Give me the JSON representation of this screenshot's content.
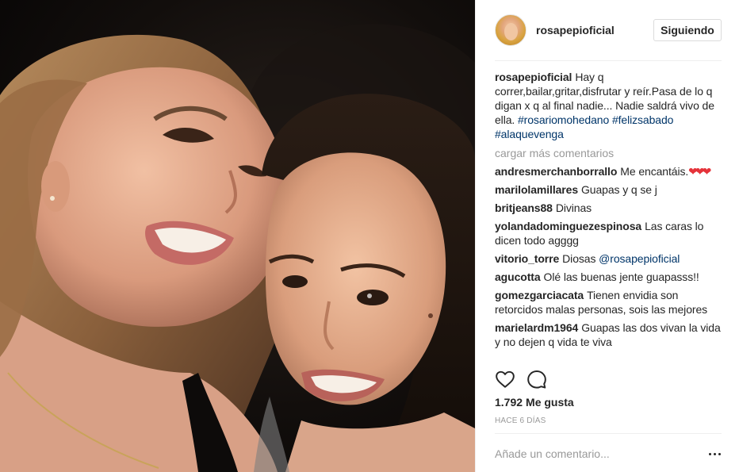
{
  "post": {
    "username": "rosapepioficial",
    "follow_label": "Siguiendo",
    "caption_text": "Hay q correr,bailar,gritar,disfrutar y reír.Pasa de lo q digan x q al final nadie... Nadie saldrá vivo de ella.",
    "caption_tags": [
      "#rosariomohedano",
      "#felizsabado",
      "#alaquevenga"
    ],
    "load_more_label": "cargar más comentarios",
    "likes_count": "1.792",
    "likes_label": "Me gusta",
    "timestamp": "HACE 6 DÍAS",
    "add_comment_placeholder": "Añade un comentario..."
  },
  "comments": [
    {
      "user": "andresmerchanborrallo",
      "text": "Me encantáis.",
      "emoji": "❤❤❤"
    },
    {
      "user": "marilolamillares",
      "text": "Guapas y q se j"
    },
    {
      "user": "britjeans88",
      "text": "Divinas"
    },
    {
      "user": "yolandadominguezespinosa",
      "text": "Las caras lo dicen todo agggg"
    },
    {
      "user": "vitorio_torre",
      "text": "Diosas",
      "mention": "@rosapepioficial"
    },
    {
      "user": "agucotta",
      "text": "Olé las buenas jente guapasss!!"
    },
    {
      "user": "gomezgarciacata",
      "text": "Tienen envidia son retorcidos malas personas, sois las mejores"
    },
    {
      "user": "marielardm1964",
      "text": "Guapas las dos vivan la vida y no dejen q vida te viva"
    }
  ],
  "icons": {
    "heart": "heart-outline-icon",
    "comment": "speech-bubble-icon",
    "more": "more-horizontal-icon"
  },
  "colors": {
    "text": "#262626",
    "muted": "#999999",
    "link": "#003569",
    "border": "#dbdbdb",
    "emoji_red": "#e5333a"
  }
}
